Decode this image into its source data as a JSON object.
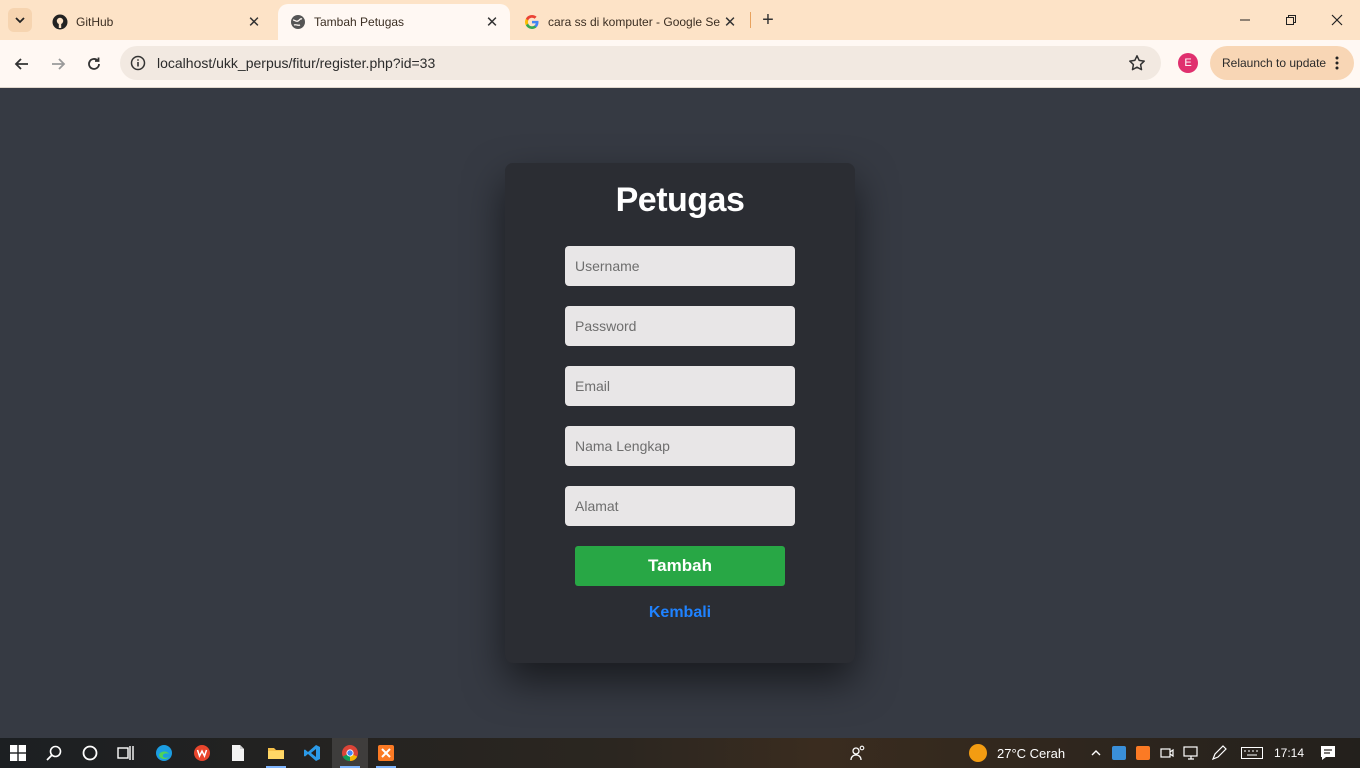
{
  "browser": {
    "tabs": [
      {
        "title": "GitHub",
        "icon": "github-icon",
        "active": false
      },
      {
        "title": "Tambah Petugas",
        "icon": "globe-icon",
        "active": true
      },
      {
        "title": "cara ss di komputer - Google Se",
        "icon": "google-icon",
        "active": false
      }
    ],
    "url": "localhost/ukk_perpus/fitur/register.php?id=33",
    "profile_initial": "E",
    "relaunch_label": "Relaunch to update"
  },
  "form": {
    "title": "Petugas",
    "fields": [
      {
        "name": "username",
        "placeholder": "Username"
      },
      {
        "name": "password",
        "placeholder": "Password"
      },
      {
        "name": "email",
        "placeholder": "Email"
      },
      {
        "name": "nama_lengkap",
        "placeholder": "Nama Lengkap"
      },
      {
        "name": "alamat",
        "placeholder": "Alamat"
      }
    ],
    "submit_label": "Tambah",
    "back_label": "Kembali"
  },
  "taskbar": {
    "weather": "27°C  Cerah",
    "time": "17:14"
  },
  "colors": {
    "page_bg": "#363a43",
    "card_bg": "#2b2d33",
    "submit_bg": "#28a745",
    "link": "#1f82ff",
    "tabstrip": "#fde3c7"
  }
}
